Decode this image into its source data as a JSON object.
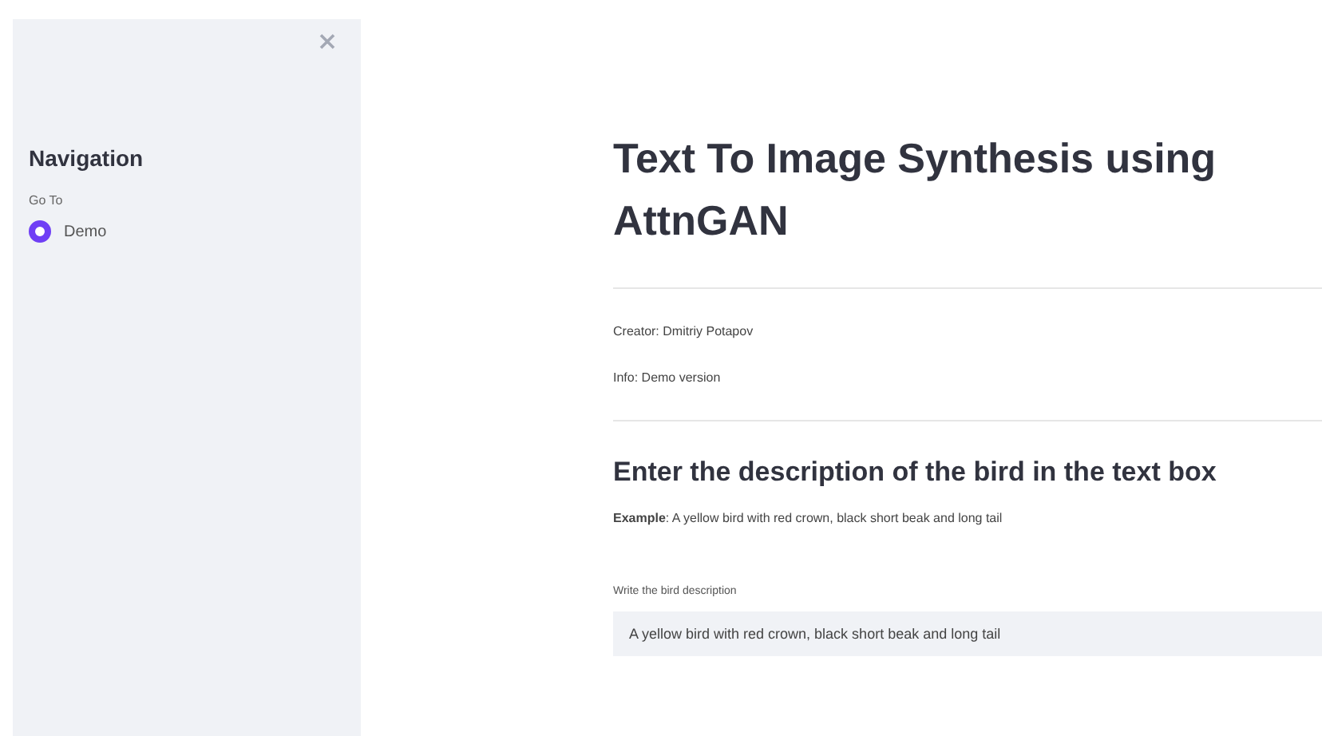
{
  "sidebar": {
    "title": "Navigation",
    "radio_label": "Go To",
    "options": [
      {
        "label": "Demo",
        "selected": true
      }
    ]
  },
  "main": {
    "title": "Text To Image Synthesis using AttnGAN",
    "creator": "Creator: Dmitriy Potapov",
    "info": "Info: Demo version",
    "subtitle": "Enter the description of the bird in the text box",
    "example": "**Example**: A yellow bird with red crown, black short beak and long tail",
    "input_label": "Write the bird description",
    "input_value": "A yellow bird with red crown, black short beak and long tail"
  }
}
